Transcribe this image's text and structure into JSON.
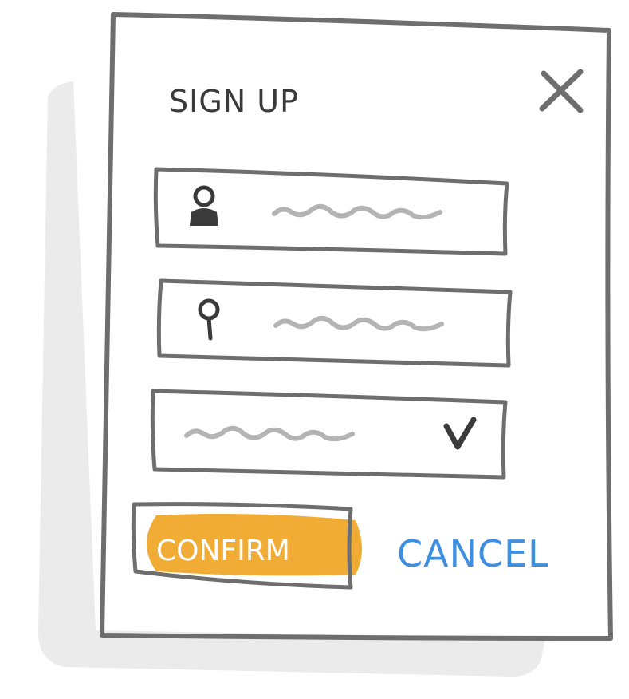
{
  "dialog": {
    "title": "SIGN UP",
    "close_icon": "close-icon"
  },
  "fields": [
    {
      "icon": "user-icon",
      "kind": "text-input"
    },
    {
      "icon": "location-pin-icon",
      "kind": "text-input"
    },
    {
      "icon": "chevron-down-icon",
      "kind": "dropdown"
    }
  ],
  "actions": {
    "confirm_label": "CONFIRM",
    "cancel_label": "CANCEL"
  },
  "colors": {
    "confirm_fill": "#f0ac35",
    "cancel_text": "#3f8fe0",
    "stroke": "#6e6e6e",
    "shadow": "#ebebeb"
  }
}
